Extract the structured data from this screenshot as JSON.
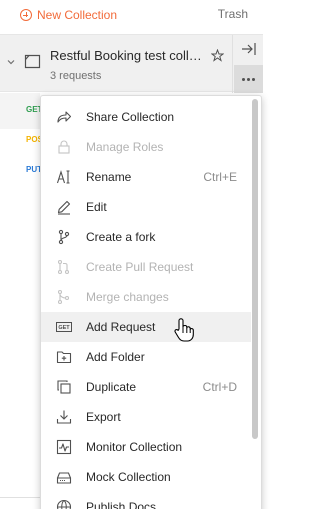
{
  "topbar": {
    "new_collection_label": "New Collection",
    "trash_label": "Trash"
  },
  "collection": {
    "name": "Restful Booking test collection",
    "subtitle": "3 requests"
  },
  "requests": [
    {
      "method": "GET",
      "color": "#2e9d4f"
    },
    {
      "method": "POST",
      "color": "#f4b400"
    },
    {
      "method": "PUT",
      "color": "#2a7ad6"
    }
  ],
  "menu": {
    "items": [
      {
        "label": "Share Collection",
        "icon": "share-icon",
        "disabled": false,
        "shortcut": ""
      },
      {
        "label": "Manage Roles",
        "icon": "lock-icon",
        "disabled": true,
        "shortcut": ""
      },
      {
        "label": "Rename",
        "icon": "rename-icon",
        "disabled": false,
        "shortcut": "Ctrl+E"
      },
      {
        "label": "Edit",
        "icon": "pencil-icon",
        "disabled": false,
        "shortcut": ""
      },
      {
        "label": "Create a fork",
        "icon": "fork-icon",
        "disabled": false,
        "shortcut": ""
      },
      {
        "label": "Create Pull Request",
        "icon": "pull-request-icon",
        "disabled": true,
        "shortcut": ""
      },
      {
        "label": "Merge changes",
        "icon": "merge-icon",
        "disabled": true,
        "shortcut": ""
      },
      {
        "label": "Add Request",
        "icon": "get-request-icon",
        "disabled": false,
        "shortcut": "",
        "hovered": true
      },
      {
        "label": "Add Folder",
        "icon": "add-folder-icon",
        "disabled": false,
        "shortcut": ""
      },
      {
        "label": "Duplicate",
        "icon": "duplicate-icon",
        "disabled": false,
        "shortcut": "Ctrl+D"
      },
      {
        "label": "Export",
        "icon": "export-icon",
        "disabled": false,
        "shortcut": ""
      },
      {
        "label": "Monitor Collection",
        "icon": "monitor-icon",
        "disabled": false,
        "shortcut": ""
      },
      {
        "label": "Mock Collection",
        "icon": "mock-server-icon",
        "disabled": false,
        "shortcut": ""
      },
      {
        "label": "Publish Docs",
        "icon": "globe-icon",
        "disabled": false,
        "shortcut": ""
      }
    ],
    "get_badge_text": "GET"
  },
  "colors": {
    "accent": "#f26b3a",
    "menu_hover": "#f0f0f0",
    "disabled_text": "#b3b3b3"
  }
}
